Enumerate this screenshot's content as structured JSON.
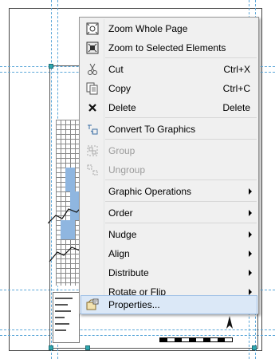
{
  "menu": {
    "items": [
      {
        "label": "Zoom Whole Page",
        "shortcut": "",
        "icon": "zoom-page-icon",
        "disabled": false,
        "submenu": false
      },
      {
        "label": "Zoom to Selected Elements",
        "shortcut": "",
        "icon": "zoom-selected-icon",
        "disabled": false,
        "submenu": false
      },
      {
        "label": "Cut",
        "shortcut": "Ctrl+X",
        "icon": "scissors-icon",
        "disabled": false,
        "submenu": false
      },
      {
        "label": "Copy",
        "shortcut": "Ctrl+C",
        "icon": "copy-icon",
        "disabled": false,
        "submenu": false
      },
      {
        "label": "Delete",
        "shortcut": "Delete",
        "icon": "delete-x-icon",
        "disabled": false,
        "submenu": false
      },
      {
        "label": "Convert To Graphics",
        "shortcut": "",
        "icon": "convert-graphics-icon",
        "disabled": false,
        "submenu": false
      },
      {
        "label": "Group",
        "shortcut": "",
        "icon": "group-icon",
        "disabled": true,
        "submenu": false
      },
      {
        "label": "Ungroup",
        "shortcut": "",
        "icon": "ungroup-icon",
        "disabled": true,
        "submenu": false
      },
      {
        "label": "Graphic Operations",
        "shortcut": "",
        "icon": "",
        "disabled": false,
        "submenu": true
      },
      {
        "label": "Order",
        "shortcut": "",
        "icon": "",
        "disabled": false,
        "submenu": true
      },
      {
        "label": "Nudge",
        "shortcut": "",
        "icon": "",
        "disabled": false,
        "submenu": true
      },
      {
        "label": "Align",
        "shortcut": "",
        "icon": "",
        "disabled": false,
        "submenu": true
      },
      {
        "label": "Distribute",
        "shortcut": "",
        "icon": "",
        "disabled": false,
        "submenu": true
      },
      {
        "label": "Rotate or Flip",
        "shortcut": "",
        "icon": "",
        "disabled": false,
        "submenu": true
      },
      {
        "label": "Properties...",
        "shortcut": "",
        "icon": "properties-icon",
        "disabled": false,
        "submenu": false,
        "highlighted": true
      }
    ]
  },
  "colors": {
    "menu_bg": "#f0f0f0",
    "highlight": "#dbe8f7",
    "guide": "#5aa6d8",
    "map_fill": "#8fb6e0",
    "selection_handle": "#2fa7b0"
  }
}
